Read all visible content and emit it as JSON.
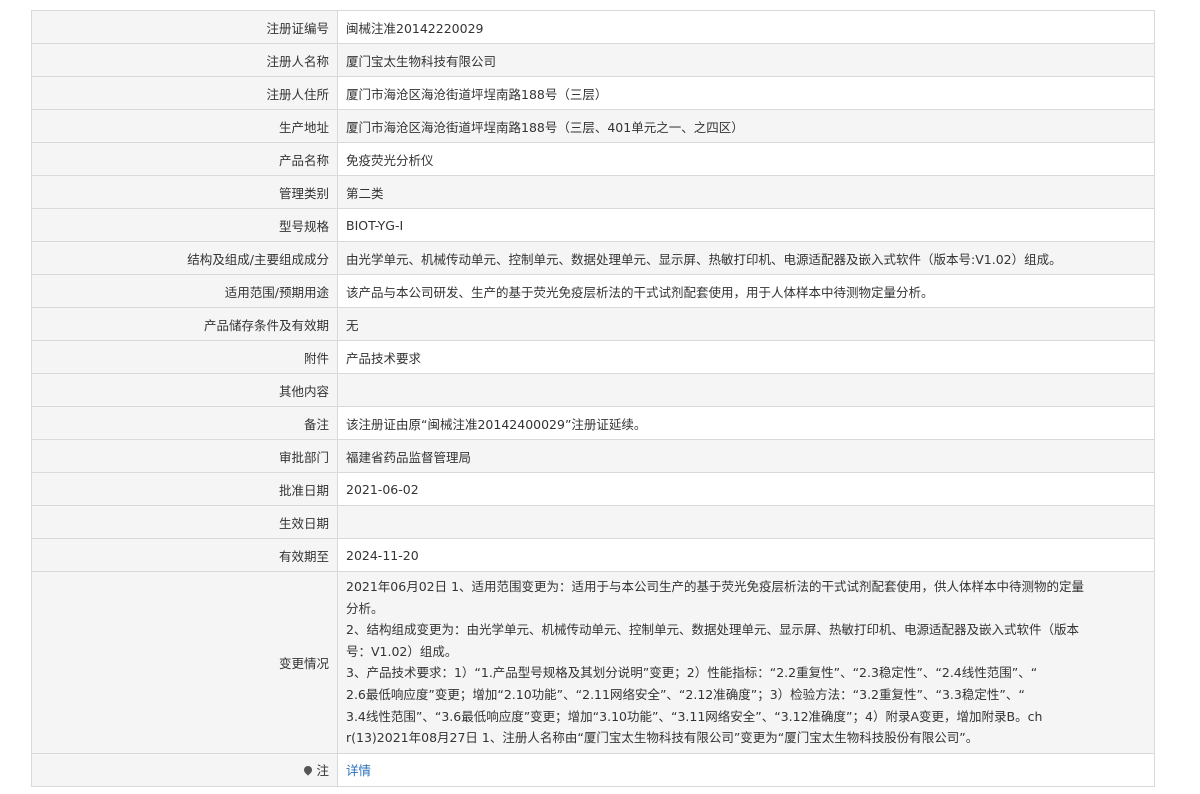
{
  "rows": [
    {
      "label": "注册证编号",
      "value": "闽械注准20142220029"
    },
    {
      "label": "注册人名称",
      "value": "厦门宝太生物科技有限公司"
    },
    {
      "label": "注册人住所",
      "value": "厦门市海沧区海沧街道坪埕南路188号（三层）"
    },
    {
      "label": "生产地址",
      "value": "厦门市海沧区海沧街道坪埕南路188号（三层、401单元之一、之四区）"
    },
    {
      "label": "产品名称",
      "value": "免疫荧光分析仪"
    },
    {
      "label": "管理类别",
      "value": "第二类"
    },
    {
      "label": "型号规格",
      "value": "BIOT-YG-I"
    },
    {
      "label": "结构及组成/主要组成成分",
      "value": "由光学单元、机械传动单元、控制单元、数据处理单元、显示屏、热敏打印机、电源适配器及嵌入式软件（版本号:V1.02）组成。"
    },
    {
      "label": "适用范围/预期用途",
      "value": "该产品与本公司研发、生产的基于荧光免疫层析法的干式试剂配套使用，用于人体样本中待测物定量分析。"
    },
    {
      "label": "产品储存条件及有效期",
      "value": "无"
    },
    {
      "label": "附件",
      "value": "产品技术要求"
    },
    {
      "label": "其他内容",
      "value": ""
    },
    {
      "label": "备注",
      "value": "该注册证由原“闽械注准20142400029”注册证延续。"
    },
    {
      "label": "审批部门",
      "value": "福建省药品监督管理局"
    },
    {
      "label": "批准日期",
      "value": "2021-06-02"
    },
    {
      "label": "生效日期",
      "value": ""
    },
    {
      "label": "有效期至",
      "value": "2024-11-20"
    }
  ],
  "change": {
    "label": "变更情况",
    "lines": [
      "2021年06月02日 1、适用范围变更为：适用于与本公司生产的基于荧光免疫层析法的干式试剂配套使用，供人体样本中待测物的定量",
      "分析。",
      "2、结构组成变更为：由光学单元、机械传动单元、控制单元、数据处理单元、显示屏、热敏打印机、电源适配器及嵌入式软件（版本",
      "号：V1.02）组成。",
      "3、产品技术要求：1）“1.产品型号规格及其划分说明”变更；2）性能指标：“2.2重复性”、“2.3稳定性”、“2.4线性范围”、“",
      "2.6最低响应度”变更；增加“2.10功能”、“2.11网络安全”、“2.12准确度”；3）检验方法：“3.2重复性”、“3.3稳定性”、“",
      "3.4线性范围”、“3.6最低响应度”变更；增加“3.10功能”、“3.11网络安全”、“3.12准确度”；4）附录A变更，增加附录B。ch",
      "r(13)2021年08月27日 1、注册人名称由“厦门宝太生物科技有限公司”变更为“厦门宝太生物科技股份有限公司”。"
    ]
  },
  "note": {
    "label": "注",
    "link": "详情",
    "icon": "pin-icon"
  }
}
